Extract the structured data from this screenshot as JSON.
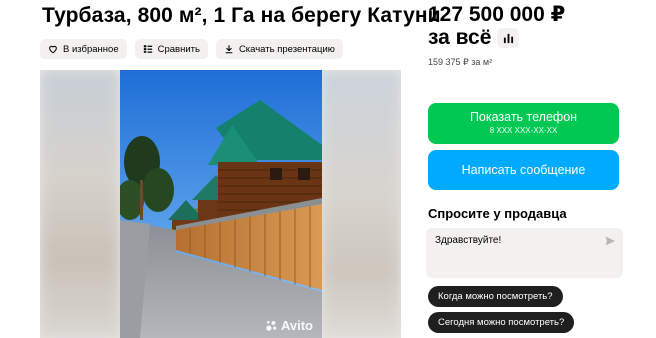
{
  "listing": {
    "title": "Турбаза, 800 м², 1 Га на берегу Катуни"
  },
  "actions": {
    "favorite_label": "В избранное",
    "compare_label": "Сравнить",
    "download_label": "Скачать презентацию"
  },
  "gallery": {
    "watermark": "Avito"
  },
  "price": {
    "amount": "127 500 000 ₽",
    "suffix": "за всё",
    "per_meter": "159 375 ₽ за м²"
  },
  "contact": {
    "phone_label": "Показать телефон",
    "phone_masked": "8 XXX XXX-XX-XX",
    "message_label": "Написать сообщение"
  },
  "ask": {
    "title": "Спросите у продавца",
    "message_value": "Здравствуйте!",
    "chips": [
      "Когда можно посмотреть?",
      "Сегодня можно посмотреть?"
    ]
  },
  "colors": {
    "green": "#00c853",
    "blue": "#00aaff",
    "chip_dark": "#1f1f1f",
    "chip_light": "#f2f1f0"
  }
}
